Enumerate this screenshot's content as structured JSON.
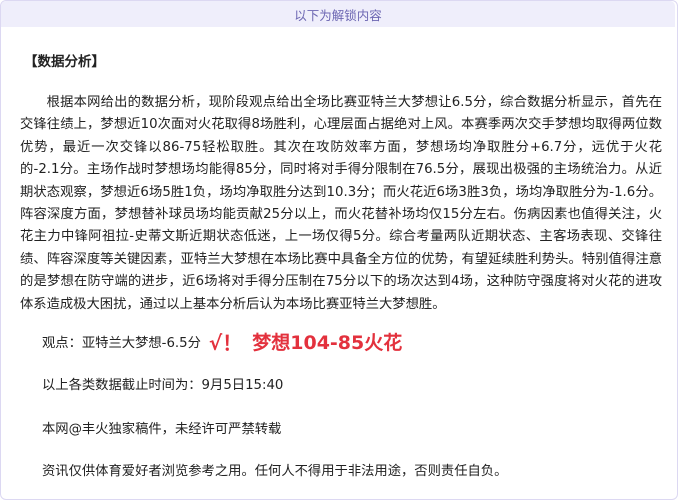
{
  "banner": "以下为解锁内容",
  "heading": "【数据分析】",
  "paragraph": "根据本网给出的数据分析，现阶段观点给出全场比赛亚特兰大梦想让6.5分，综合数据分析显示，首先在交锋往绩上，梦想近10次面对火花取得8场胜利，心理层面占据绝对上风。本赛季两次交手梦想均取得两位数优势，最近一次交锋以86-75轻松取胜。其次在攻防效率方面，梦想场均净取胜分+6.7分，远优于火花的-2.1分。主场作战时梦想场均能得85分，同时将对手得分限制在76.5分，展现出极强的主场统治力。从近期状态观察，梦想近6场5胜1负，场均净取胜分达到10.3分；而火花近6场3胜3负，场均净取胜分为-1.6分。阵容深度方面，梦想替补球员场均能贡献25分以上，而火花替补场均仅15分左右。伤病因素也值得关注，火花主力中锋阿祖拉-史蒂文斯近期状态低迷，上一场仅得5分。综合考量两队近期状态、主客场表现、交锋往绩、阵容深度等关键因素，亚特兰大梦想在本场比赛中具备全方位的优势，有望延续胜利势头。特别值得注意的是梦想在防守端的进步，近6场将对手得分压制在75分以下的场次达到4场，这种防守强度将对火花的进攻体系造成极大困扰，通过以上基本分析后认为本场比赛亚特兰大梦想胜。",
  "verdict": {
    "label": "观点：亚特兰大梦想-6.5分",
    "check": "√！",
    "result": "梦想104-85火花"
  },
  "cutoff": "以上各类数据截止时间为：9月5日15:40",
  "copyright": "本网@丰火独家稿件，未经许可严禁转载",
  "disclaimer": "资讯仅供体育爱好者浏览参考之用。任何人不得用于非法用途，否则责任自负。",
  "colors": {
    "accent_red": "#e3313d",
    "banner_bg": "#efeefb",
    "banner_text": "#6d67b3"
  }
}
